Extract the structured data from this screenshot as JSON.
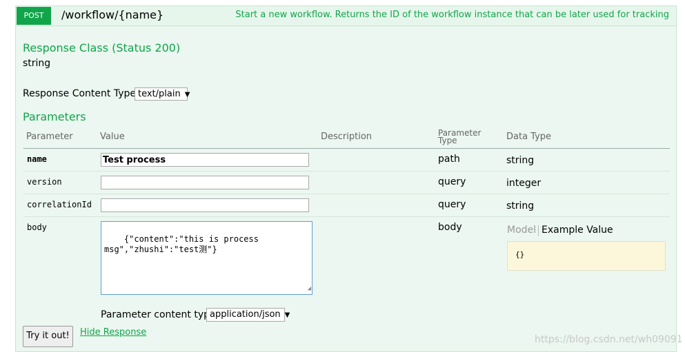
{
  "operation": {
    "method": "POST",
    "path": "/workflow/{name}",
    "summary": "Start a new workflow. Returns the ID of the workflow instance that can be later used for tracking"
  },
  "response_class": {
    "title": "Response Class (Status 200)",
    "type": "string"
  },
  "response_content_type": {
    "label": "Response Content Type",
    "selected": "text/plain"
  },
  "parameters": {
    "title": "Parameters",
    "headers": {
      "parameter": "Parameter",
      "value": "Value",
      "description": "Description",
      "param_type_1": "Parameter",
      "param_type_2": "Type",
      "data_type": "Data Type"
    },
    "rows": [
      {
        "name": "name",
        "value": "Test process",
        "param_type": "path",
        "data_type": "string"
      },
      {
        "name": "version",
        "value": "",
        "param_type": "query",
        "data_type": "integer"
      },
      {
        "name": "correlationId",
        "value": "",
        "param_type": "query",
        "data_type": "string"
      },
      {
        "name": "body",
        "value": "{\"content\":\"this is process\nmsg\",\"zhushi\":\"test测\"}",
        "param_type": "body"
      }
    ],
    "model_tab": "Model",
    "example_tab": "Example Value",
    "example_value": "{}",
    "content_type_label": "Parameter content type:",
    "content_type_selected": "application/json"
  },
  "actions": {
    "try_button": "Try it out!",
    "hide_response": "Hide Response"
  },
  "watermark": "https://blog.csdn.net/wh09091"
}
